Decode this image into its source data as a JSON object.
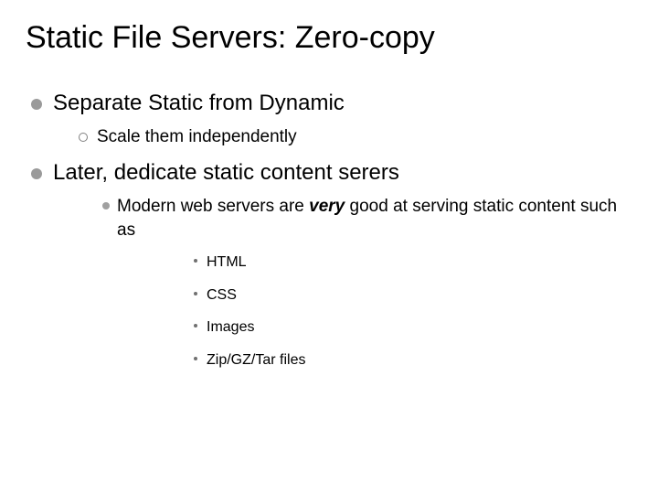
{
  "title": "Static File Servers: Zero-copy",
  "bullets": [
    {
      "text": "Separate Static from Dynamic",
      "children": [
        {
          "text": "Scale them independently"
        }
      ]
    },
    {
      "text": "Later, dedicate static content serers",
      "children": [
        {
          "text_pre": "Modern web servers are ",
          "text_em": "very",
          "text_post": " good at serving static content such as",
          "children": [
            {
              "text": "HTML"
            },
            {
              "text": "CSS"
            },
            {
              "text": "Images"
            },
            {
              "text": "Zip/GZ/Tar files"
            }
          ]
        }
      ]
    }
  ]
}
